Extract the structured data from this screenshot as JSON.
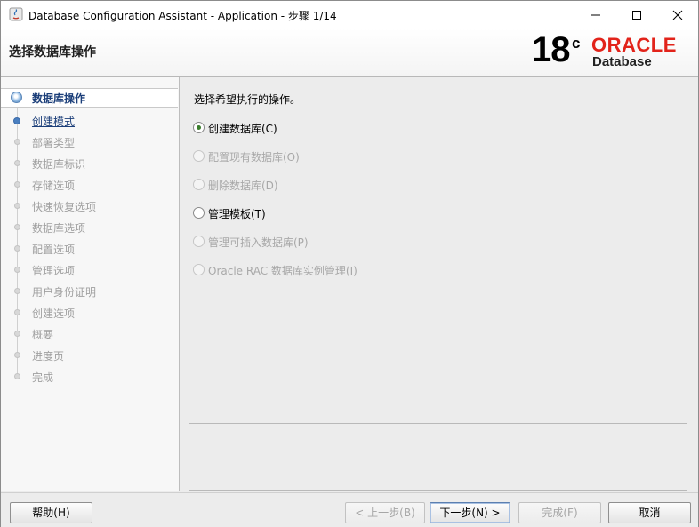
{
  "window": {
    "title": "Database Configuration Assistant - Application - 步骤 1/14"
  },
  "header": {
    "title": "选择数据库操作",
    "logo": {
      "version": "18",
      "version_suffix": "c",
      "brand": "ORACLE",
      "product": "Database"
    },
    "brand_color": "#e2231a"
  },
  "steps": [
    {
      "label": "数据库操作",
      "state": "active"
    },
    {
      "label": "创建模式",
      "state": "link"
    },
    {
      "label": "部署类型",
      "state": "disabled"
    },
    {
      "label": "数据库标识",
      "state": "disabled"
    },
    {
      "label": "存储选项",
      "state": "disabled"
    },
    {
      "label": "快速恢复选项",
      "state": "disabled"
    },
    {
      "label": "数据库选项",
      "state": "disabled"
    },
    {
      "label": "配置选项",
      "state": "disabled"
    },
    {
      "label": "管理选项",
      "state": "disabled"
    },
    {
      "label": "用户身份证明",
      "state": "disabled"
    },
    {
      "label": "创建选项",
      "state": "disabled"
    },
    {
      "label": "概要",
      "state": "disabled"
    },
    {
      "label": "进度页",
      "state": "disabled"
    },
    {
      "label": "完成",
      "state": "disabled"
    }
  ],
  "main": {
    "prompt": "选择希望执行的操作。",
    "options": [
      {
        "label": "创建数据库(C)",
        "checked": true,
        "enabled": true
      },
      {
        "label": "配置现有数据库(O)",
        "checked": false,
        "enabled": false
      },
      {
        "label": "删除数据库(D)",
        "checked": false,
        "enabled": false
      },
      {
        "label": "管理模板(T)",
        "checked": false,
        "enabled": true
      },
      {
        "label": "管理可插入数据库(P)",
        "checked": false,
        "enabled": false
      },
      {
        "label": "Oracle RAC 数据库实例管理(I)",
        "checked": false,
        "enabled": false
      }
    ]
  },
  "buttons": {
    "help": "帮助(H)",
    "back": "< 上一步(B)",
    "next": "下一步(N) >",
    "finish": "完成(F)",
    "cancel": "取消"
  }
}
